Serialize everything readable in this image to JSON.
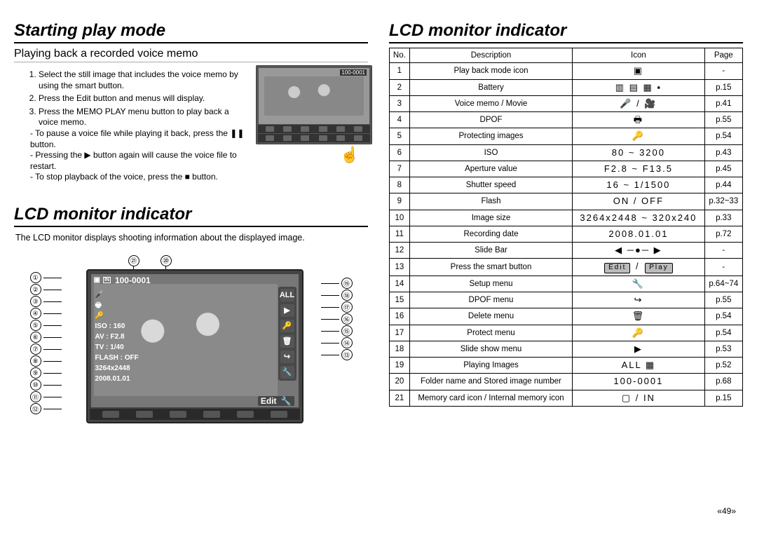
{
  "left": {
    "heading1": "Starting play mode",
    "subtitle": "Playing back a recorded voice memo",
    "steps": [
      "Select the still image that includes the voice memo by using the smart button.",
      "Press the Edit button and menus will display.",
      "Press the MEMO PLAY menu button to play back a voice memo."
    ],
    "subnotes": [
      "To pause a voice file while playing it back, press the ❚❚ button.",
      "Pressing the  ▶  button again will cause the voice file to restart.",
      "To stop playback of the voice, press the  ■  button."
    ],
    "small_folder_label": "100-0001",
    "heading2": "LCD monitor indicator",
    "intro": "The LCD monitor displays shooting information about the displayed image.",
    "big": {
      "folder": "100-0001",
      "overlay": {
        "iso": "ISO : 160",
        "av": "AV : F2.8",
        "tv": "TV : 1/40",
        "flash": "FLASH : OFF",
        "size": "3264x2448",
        "date": "2008.01.01"
      },
      "edit_label": "Edit",
      "right_icons": [
        "ALL",
        "▶",
        "🔑",
        "🗑",
        "↪",
        "🔧"
      ]
    },
    "callout_left": [
      "①",
      "②",
      "③",
      "④",
      "⑤",
      "⑥",
      "⑦",
      "⑧",
      "⑨",
      "⑩",
      "⑪",
      "⑫"
    ],
    "callout_right": [
      "⑲",
      "⑱",
      "⑰",
      "⑯",
      "⑮",
      "⑭",
      "⑬"
    ],
    "callout_top": [
      "㉑",
      "⑳"
    ]
  },
  "right": {
    "heading": "LCD monitor indicator",
    "headers": {
      "no": "No.",
      "desc": "Description",
      "icon": "Icon",
      "page": "Page"
    },
    "rows": [
      {
        "no": "1",
        "desc": "Play back mode icon",
        "icon": "▣",
        "page": "-"
      },
      {
        "no": "2",
        "desc": "Battery",
        "icon": "▥ ▤ ▦ ▪",
        "page": "p.15"
      },
      {
        "no": "3",
        "desc": "Voice memo / Movie",
        "icon": "🎤  /  🎥",
        "page": "p.41"
      },
      {
        "no": "4",
        "desc": "DPOF",
        "icon": "🖶",
        "page": "p.55"
      },
      {
        "no": "5",
        "desc": "Protecting images",
        "icon": "🔑",
        "page": "p.54"
      },
      {
        "no": "6",
        "desc": "ISO",
        "icon": "80 ~ 3200",
        "page": "p.43"
      },
      {
        "no": "7",
        "desc": "Aperture value",
        "icon": "F2.8 ~ F13.5",
        "page": "p.45"
      },
      {
        "no": "8",
        "desc": "Shutter speed",
        "icon": "16 ~ 1/1500",
        "page": "p.44"
      },
      {
        "no": "9",
        "desc": "Flash",
        "icon": "ON / OFF",
        "page": "p.32~33"
      },
      {
        "no": "10",
        "desc": "Image size",
        "icon": "3264x2448 ~ 320x240",
        "page": "p.33"
      },
      {
        "no": "11",
        "desc": "Recording date",
        "icon": "2008.01.01",
        "page": "p.72"
      },
      {
        "no": "12",
        "desc": "Slide Bar",
        "icon": "◀ ─●─ ▶",
        "page": "-"
      },
      {
        "no": "13",
        "desc": "Press the smart button",
        "icon": "<span class='pill'>Edit</span> / <span class='pill'>Play</span>",
        "page": "-"
      },
      {
        "no": "14",
        "desc": "Setup menu",
        "icon": "🔧",
        "page": "p.64~74"
      },
      {
        "no": "15",
        "desc": "DPOF menu",
        "icon": "↪",
        "page": "p.55"
      },
      {
        "no": "16",
        "desc": "Delete menu",
        "icon": "🗑",
        "page": "p.54"
      },
      {
        "no": "17",
        "desc": "Protect menu",
        "icon": "🔑",
        "page": "p.54"
      },
      {
        "no": "18",
        "desc": "Slide show menu",
        "icon": "▶",
        "page": "p.53"
      },
      {
        "no": "19",
        "desc": "Playing Images",
        "icon": "ALL  ▦",
        "page": "p.52"
      },
      {
        "no": "20",
        "desc": "Folder name and Stored image number",
        "icon": "100-0001",
        "page": "p.68"
      },
      {
        "no": "21",
        "desc": "Memory card icon / Internal memory icon",
        "icon": "▢  /  IN",
        "page": "p.15"
      }
    ]
  },
  "page_num": "«49»"
}
